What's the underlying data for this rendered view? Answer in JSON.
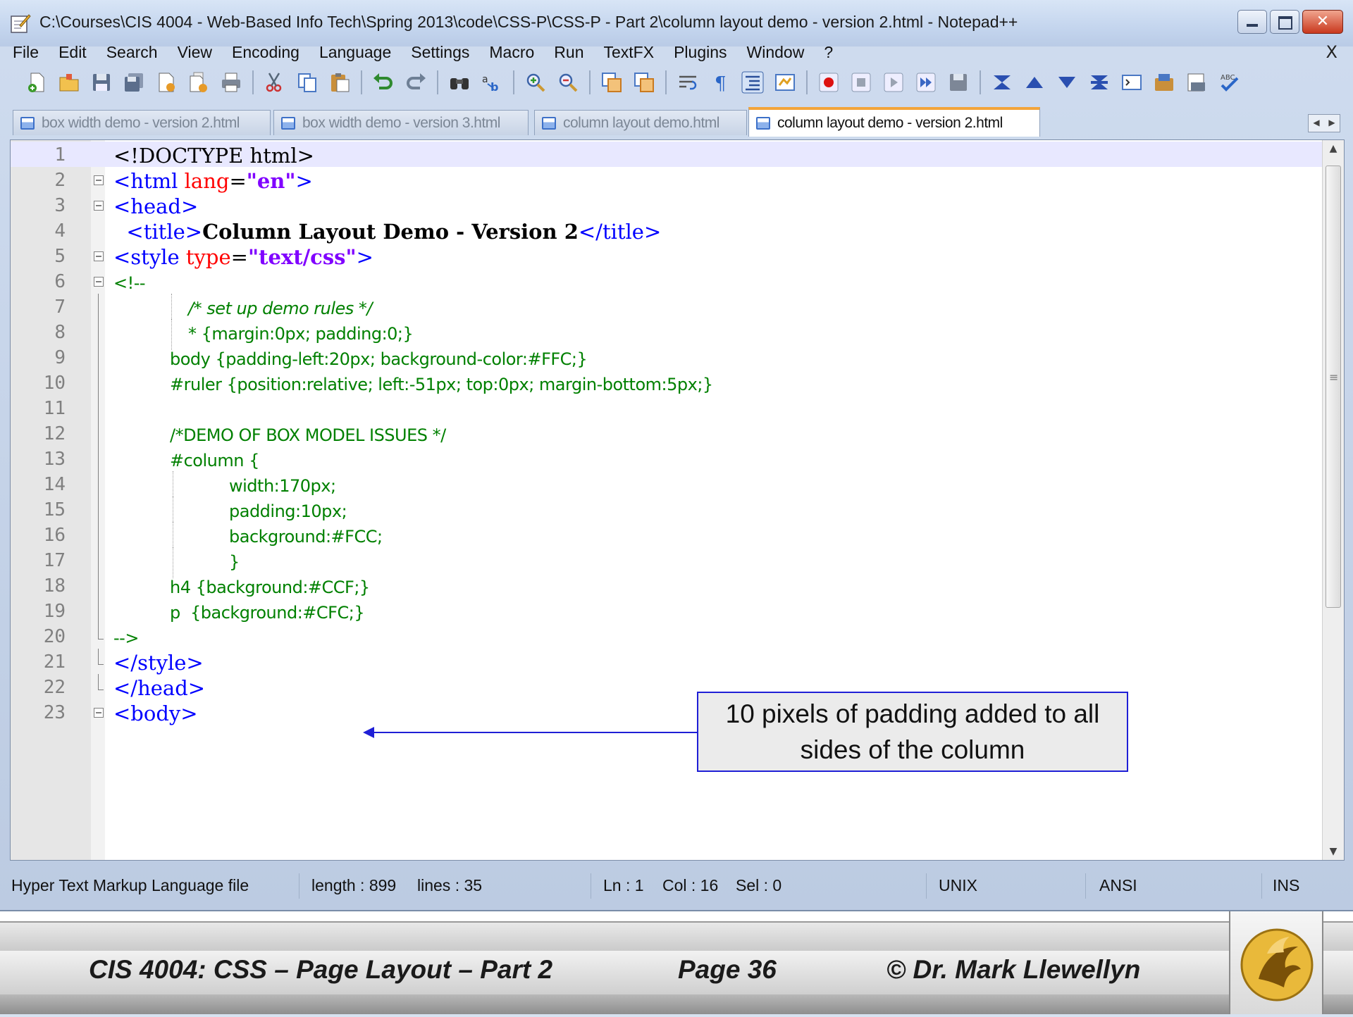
{
  "window": {
    "title": "C:\\Courses\\CIS 4004 - Web-Based Info Tech\\Spring 2013\\code\\CSS-P\\CSS-P - Part 2\\column layout demo - version 2.html - Notepad++",
    "close_glyph": "✕"
  },
  "menu": {
    "items": [
      "File",
      "Edit",
      "Search",
      "View",
      "Encoding",
      "Language",
      "Settings",
      "Macro",
      "Run",
      "TextFX",
      "Plugins",
      "Window",
      "?"
    ],
    "close_label": "X"
  },
  "tabs": [
    {
      "label": "box width demo - version 2.html",
      "active": false
    },
    {
      "label": "box width demo - version 3.html",
      "active": false
    },
    {
      "label": "column layout demo.html",
      "active": false
    },
    {
      "label": "column layout demo - version 2.html",
      "active": true
    }
  ],
  "editor": {
    "lines": [
      {
        "n": "1",
        "parts": [
          [
            "doc",
            "<!DOCTYPE html>"
          ]
        ]
      },
      {
        "n": "2",
        "parts": [
          [
            "tag",
            "<html "
          ],
          [
            "attr",
            "lang"
          ],
          [
            "doc",
            "="
          ],
          [
            "val",
            "\"en\""
          ],
          [
            "tag",
            ">"
          ]
        ]
      },
      {
        "n": "3",
        "parts": [
          [
            "tag",
            "<head>"
          ]
        ]
      },
      {
        "n": "4",
        "parts": [
          [
            "tag",
            "  <title>"
          ],
          [
            "txt",
            "Column Layout Demo - Version 2"
          ],
          [
            "tag",
            "</title>"
          ]
        ]
      },
      {
        "n": "5",
        "parts": [
          [
            "tag",
            "<style "
          ],
          [
            "attr",
            "type"
          ],
          [
            "doc",
            "="
          ],
          [
            "val",
            "\"text/css\""
          ],
          [
            "tag",
            ">"
          ]
        ]
      },
      {
        "n": "6",
        "parts": [
          [
            "green",
            "<!--"
          ]
        ]
      },
      {
        "n": "7",
        "parts": [
          [
            "comment",
            "/* set up demo rules */"
          ]
        ]
      },
      {
        "n": "8",
        "parts": [
          [
            "green",
            "* {margin:0px; padding:0;}"
          ]
        ]
      },
      {
        "n": "9",
        "parts": [
          [
            "green",
            "body {padding-left:20px; background-color:#FFC;}"
          ]
        ]
      },
      {
        "n": "10",
        "parts": [
          [
            "green",
            "#ruler {position:relative; left:-51px; top:0px; margin-bottom:5px;}"
          ]
        ]
      },
      {
        "n": "11",
        "parts": []
      },
      {
        "n": "12",
        "parts": [
          [
            "green",
            "/*DEMO OF BOX MODEL ISSUES */"
          ]
        ]
      },
      {
        "n": "13",
        "parts": [
          [
            "green",
            "#column {"
          ]
        ]
      },
      {
        "n": "14",
        "parts": [
          [
            "green",
            "width:170px;"
          ]
        ]
      },
      {
        "n": "15",
        "parts": [
          [
            "green",
            "padding:10px;"
          ]
        ]
      },
      {
        "n": "16",
        "parts": [
          [
            "green",
            "background:#FCC;"
          ]
        ]
      },
      {
        "n": "17",
        "parts": [
          [
            "green",
            "}"
          ]
        ]
      },
      {
        "n": "18",
        "parts": [
          [
            "green",
            "h4 {background:#CCF;}"
          ]
        ]
      },
      {
        "n": "19",
        "parts": [
          [
            "green",
            "p  {background:#CFC;}"
          ]
        ]
      },
      {
        "n": "20",
        "parts": [
          [
            "green",
            "-->"
          ]
        ]
      },
      {
        "n": "21",
        "parts": [
          [
            "tag",
            "</style>"
          ]
        ]
      },
      {
        "n": "22",
        "parts": [
          [
            "tag",
            "</head>"
          ]
        ]
      },
      {
        "n": "23",
        "parts": [
          [
            "tag",
            "<body>"
          ]
        ]
      }
    ],
    "callout": "10 pixels of padding added to all sides of the column"
  },
  "status": {
    "file_type": "Hyper Text Markup Language file",
    "length": "length : 899",
    "lines": "lines : 35",
    "ln": "Ln : 1",
    "col": "Col : 16",
    "sel": "Sel : 0",
    "eol": "UNIX",
    "encoding": "ANSI",
    "mode": "INS"
  },
  "footer": {
    "course": "CIS 4004: CSS – Page Layout – Part 2",
    "page": "Page 36",
    "author": "© Dr. Mark Llewellyn"
  }
}
